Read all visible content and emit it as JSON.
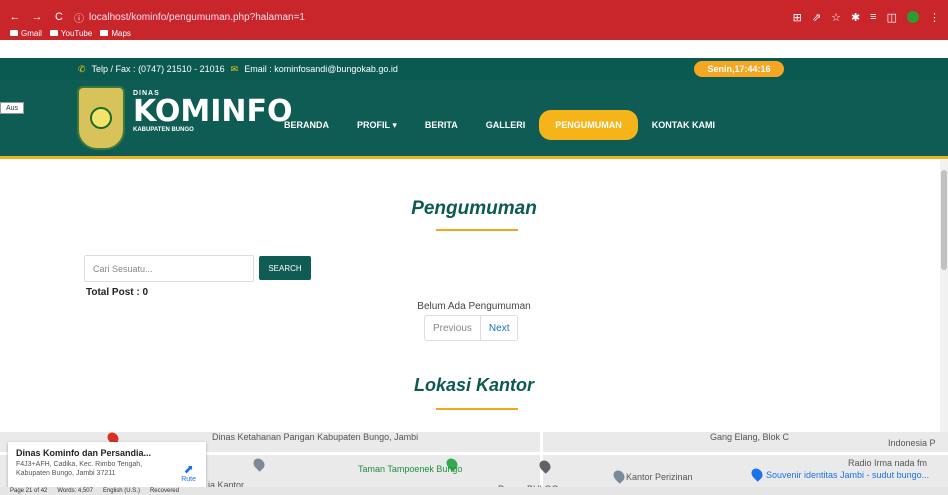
{
  "browser": {
    "url": "localhost/kominfo/pengumuman.php?halaman=1",
    "bookmarks": [
      "Gmail",
      "YouTube",
      "Maps"
    ]
  },
  "info_bar": {
    "contact": "Telp / Fax : (0747) 21510 - 21016",
    "email": "Email : kominfosandi@bungokab.go.id",
    "date": "Senin,17:44:16"
  },
  "header": {
    "side_tab": "Aus",
    "brand_small": "DINAS",
    "brand_main": "KOMINFO",
    "brand_sub": "KABUPATEN BUNGO",
    "nav": [
      "BERANDA",
      "PROFIL ▾",
      "BERITA",
      "GALLERI",
      "PENGUMUMAN",
      "KONTAK KAMI"
    ]
  },
  "content": {
    "title": "Pengumuman",
    "search_placeholder": "Cari Sesuatu...",
    "search_button": "SEARCH",
    "total": "Total Post : 0",
    "empty": "Belum Ada Pengumuman",
    "prev": "Previous",
    "next": "Next",
    "location_title": "Lokasi Kantor"
  },
  "map": {
    "card_name": "Dinas Kominfo dan Persandia...",
    "card_address": "F4J3+AFH, Cadika, Kec. Rimbo Tengah, Kabupaten Bungo, Jambi 37211",
    "route": "Rute",
    "labels": [
      "Dinas Ketahanan Pangan Kabupaten Bungo, Jambi",
      "Taman Tampoenek Bungo",
      "Kantor Perizinan",
      "Souvenir identitas Jambi - sudut bungo...",
      "Radio Irma nada fm",
      "Indonesia P",
      "Gang Elang, Blok C",
      "Perum BULOG",
      "ja Kantor"
    ]
  },
  "statusbar": {
    "page": "Page 21 of 42",
    "words": "Words: 4,507",
    "lang": "English (U.S.)",
    "zoom": "Recovered"
  },
  "colors": {
    "chrome": "#c9262c",
    "primary": "#0f5c54",
    "accent": "#f5b41a"
  }
}
